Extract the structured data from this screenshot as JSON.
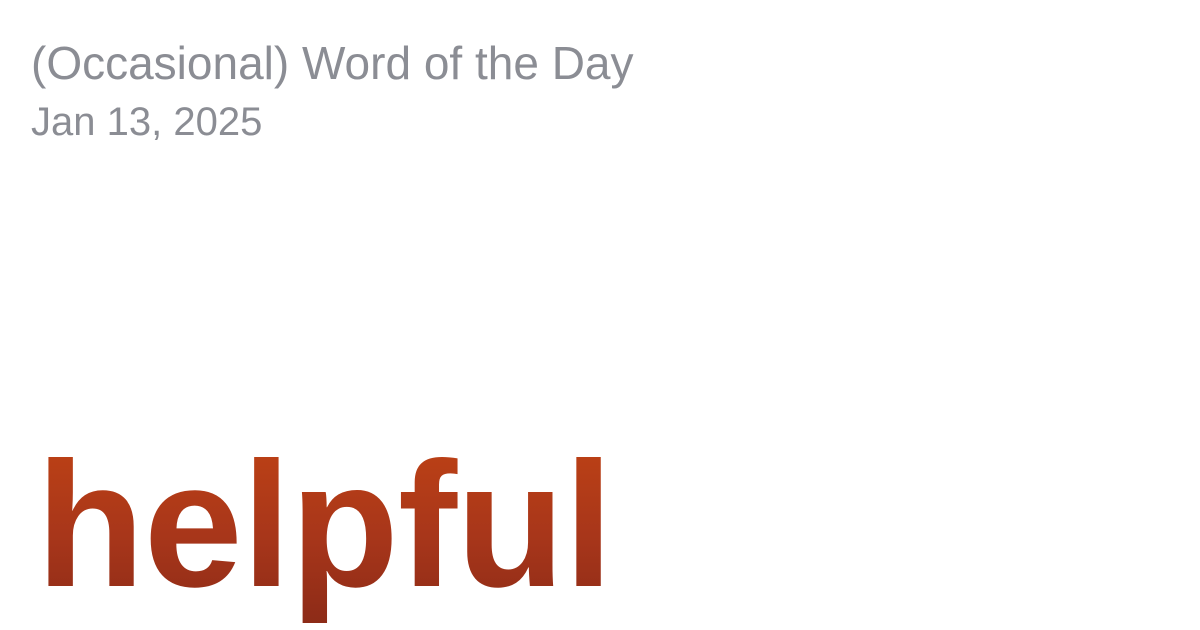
{
  "header": {
    "title": "(Occasional) Word of the Day",
    "date": "Jan 13, 2025"
  },
  "word": {
    "text": "helpful"
  },
  "colors": {
    "muted_text": "#8b8d94",
    "word_gradient_top": "#c24414",
    "word_gradient_bottom": "#8a2a17",
    "background": "#ffffff"
  }
}
